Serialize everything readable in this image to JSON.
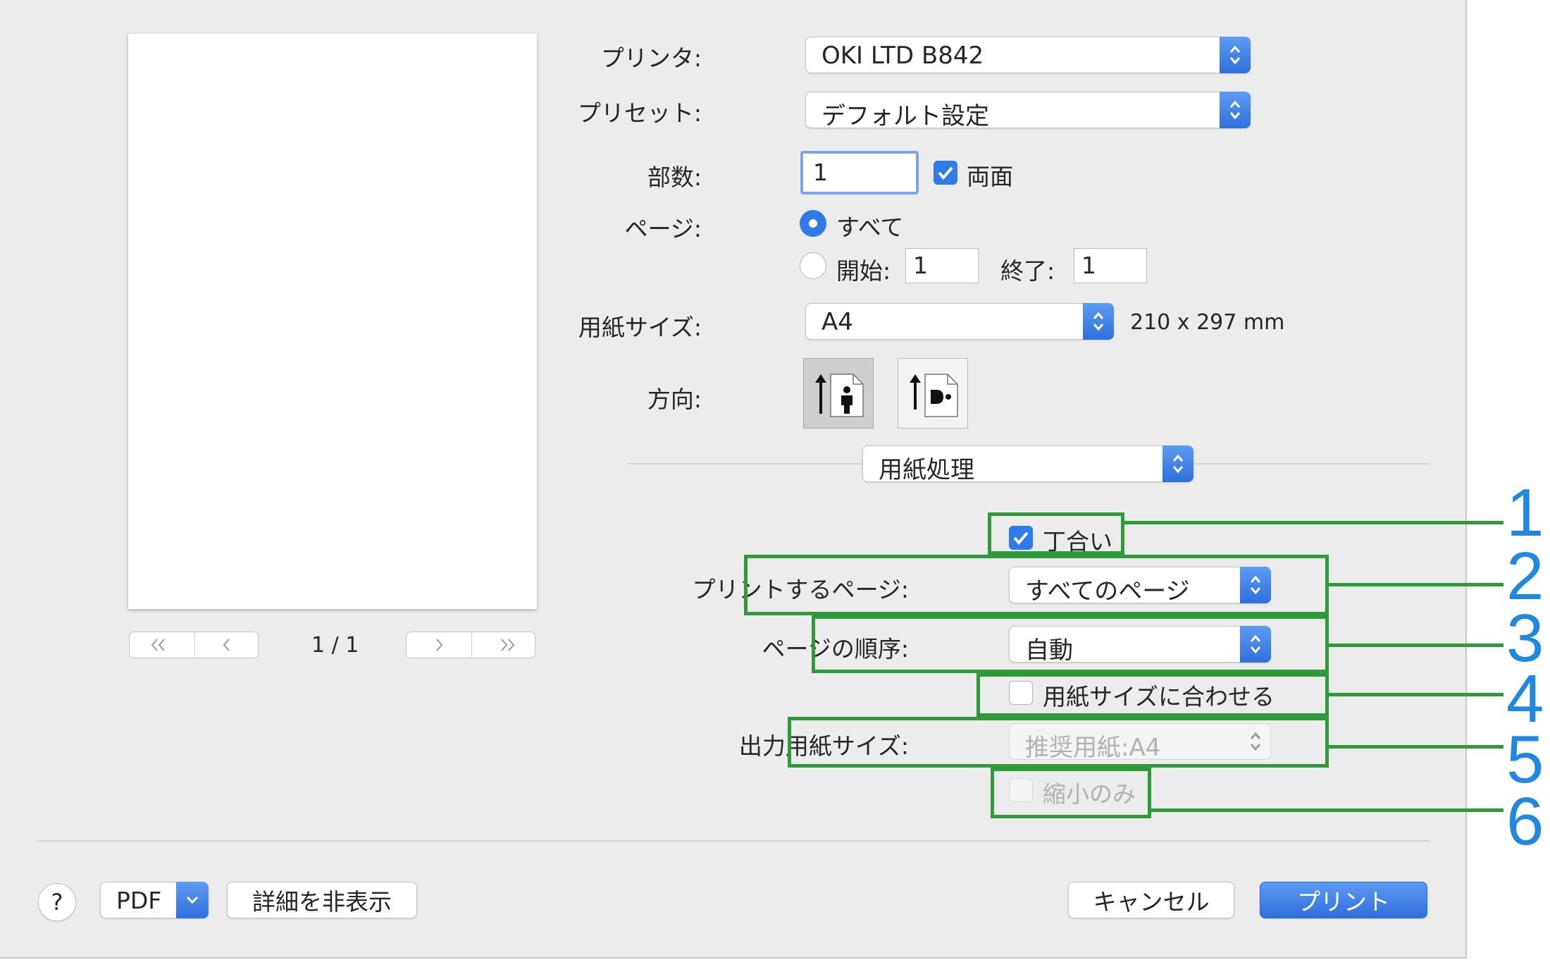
{
  "printer": {
    "label": "プリンタ:",
    "value": "OKI LTD B842"
  },
  "preset": {
    "label": "プリセット:",
    "value": "デフォルト設定"
  },
  "copies": {
    "label": "部数:",
    "value": "1",
    "duplex_label": "両面",
    "duplex_checked": true
  },
  "pages": {
    "label": "ページ:",
    "all_label": "すべて",
    "from_label": "開始:",
    "from_value": "1",
    "to_label": "終了:",
    "to_value": "1"
  },
  "paper_size": {
    "label": "用紙サイズ:",
    "value": "A4",
    "dimensions": "210 x 297 mm"
  },
  "orientation": {
    "label": "方向:"
  },
  "section_popup": {
    "value": "用紙処理"
  },
  "paper_handling": {
    "collate_label": "丁合い",
    "pages_to_print_label": "プリントするページ:",
    "pages_to_print_value": "すべてのページ",
    "page_order_label": "ページの順序:",
    "page_order_value": "自動",
    "scale_to_fit_label": "用紙サイズに合わせる",
    "dest_paper_size_label": "出力用紙サイズ:",
    "dest_paper_size_value": "推奨用紙:A4",
    "scale_down_only_label": "縮小のみ"
  },
  "preview": {
    "page_indicator": "1 / 1"
  },
  "footer": {
    "help": "?",
    "pdf": "PDF",
    "hide_details": "詳細を非表示",
    "cancel": "キャンセル",
    "print": "プリント"
  },
  "callouts": [
    "1",
    "2",
    "3",
    "4",
    "5",
    "6"
  ],
  "colors": {
    "accent": "#2f7bea",
    "callout_box": "#2e9a3a",
    "callout_number": "#1e88e5"
  }
}
